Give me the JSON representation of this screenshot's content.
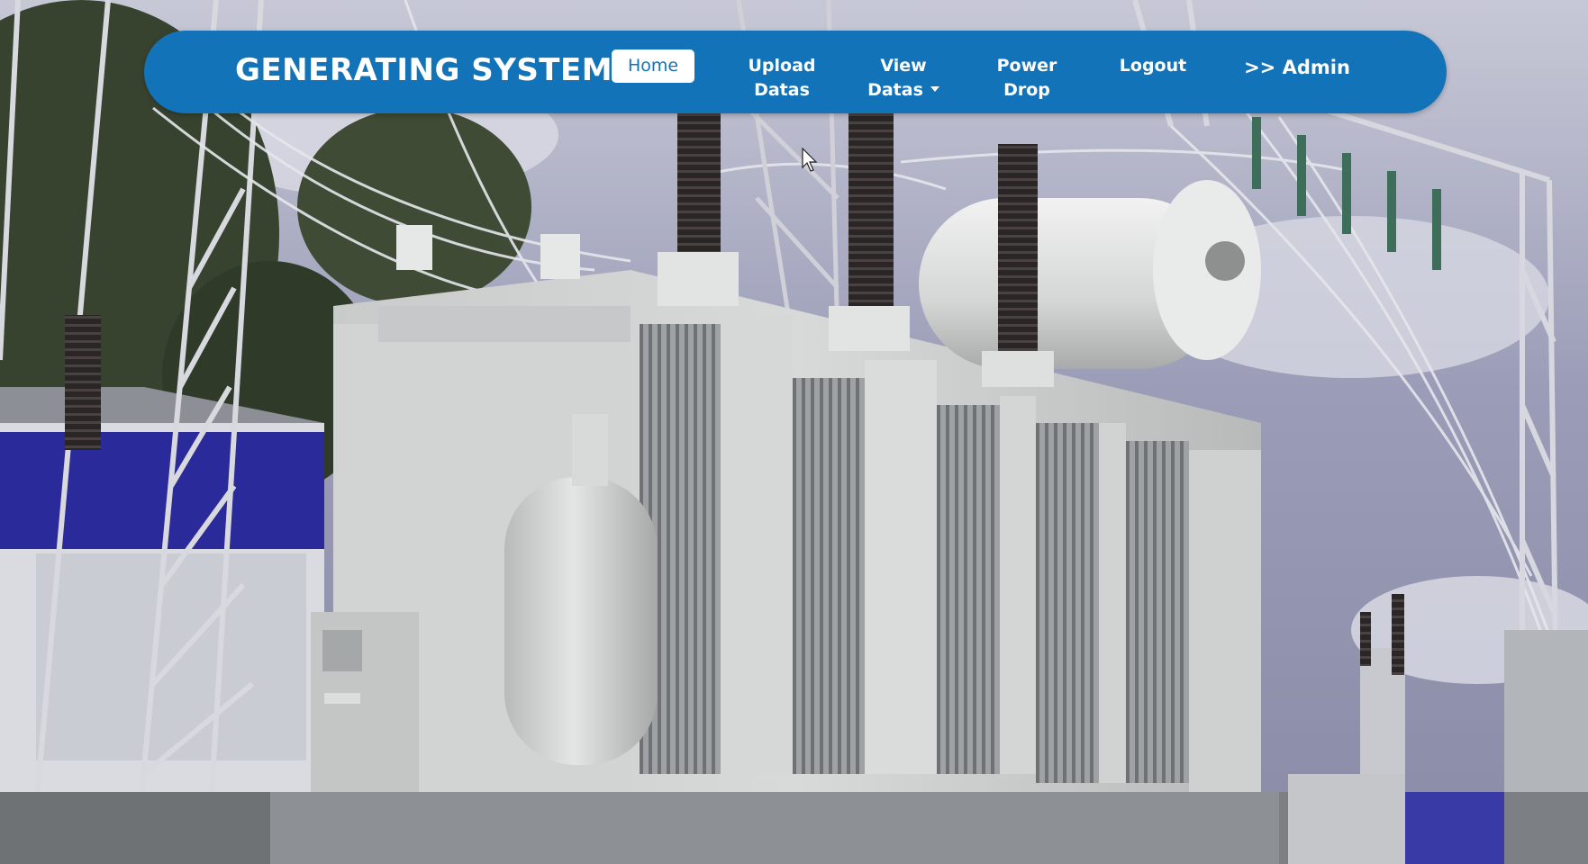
{
  "navbar": {
    "brand": "GENERATING SYSTEM",
    "items": [
      {
        "id": "home",
        "label": "Home",
        "active": true
      },
      {
        "id": "upload",
        "line1": "Upload",
        "line2": "Datas"
      },
      {
        "id": "view",
        "line1": "View",
        "line2": "Datas",
        "dropdown": true
      },
      {
        "id": "power",
        "line1": "Power",
        "line2": "Drop"
      },
      {
        "id": "logout",
        "label": "Logout"
      },
      {
        "id": "admin",
        "label": ">> Admin"
      }
    ]
  },
  "colors": {
    "navbar_bg": "#1273b8",
    "active_text": "#1273b8",
    "nav_text": "#ffffff"
  },
  "background": {
    "subject": "high-voltage power transformer at electrical substation"
  }
}
